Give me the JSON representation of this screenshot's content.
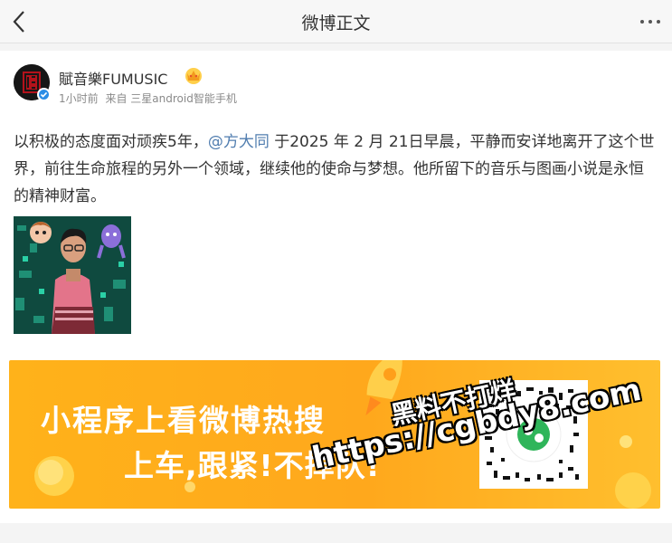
{
  "navbar": {
    "title": "微博正文",
    "back_icon": "chevron-left-icon",
    "more_icon": "more-dots-icon"
  },
  "post": {
    "username": "賦音樂FUMUSIC",
    "time": "1小时前",
    "source": "来自 三星android智能手机",
    "text_before": "以积极的态度面对顽疾5年，",
    "mention": "@方大同",
    "text_after": " 于2025 年 2 月 21日早晨，平静而安详地离开了这个世界，前往生命旅程的另外一个领域，继续他的使命与梦想。他所留下的音乐与图画小说是永恒的精神财富。"
  },
  "banner": {
    "line1": "小程序上看微博热搜",
    "line2": "上车,跟紧!不掉队!"
  },
  "watermark": {
    "line1": "黑料不打烊",
    "line2": "https://cgbdy8.com"
  },
  "colors": {
    "mention": "#507daf",
    "banner": "#ffb21a",
    "verified": "#2b8de6"
  }
}
